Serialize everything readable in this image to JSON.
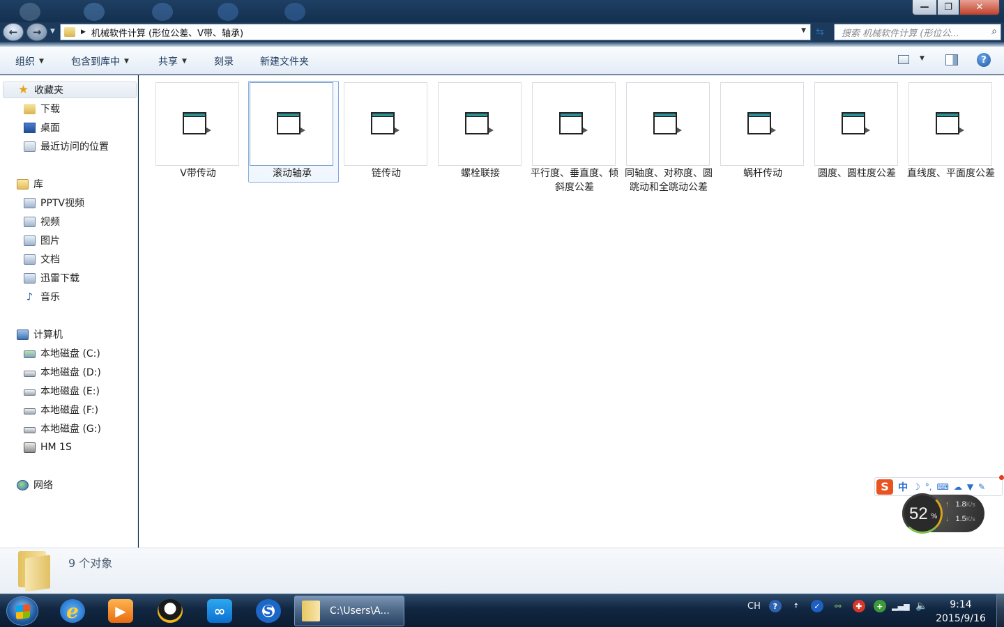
{
  "window": {
    "address_path": "机械软件计算 (形位公差、V带、轴承)",
    "search_placeholder": "搜索 机械软件计算 (形位公...",
    "controls": {
      "minimize": "—",
      "maximize": "❐",
      "close": "✕"
    }
  },
  "toolbar": {
    "organize": "组织",
    "include_in_library": "包含到库中",
    "share": "共享",
    "burn": "刻录",
    "new_folder": "新建文件夹",
    "help": "?"
  },
  "sidebar": {
    "favorites": {
      "label": "收藏夹",
      "items": [
        "下载",
        "桌面",
        "最近访问的位置"
      ]
    },
    "libraries": {
      "label": "库",
      "items": [
        "PPTV视频",
        "视频",
        "图片",
        "文档",
        "迅雷下载",
        "音乐"
      ]
    },
    "computer": {
      "label": "计算机",
      "items": [
        "本地磁盘 (C:)",
        "本地磁盘 (D:)",
        "本地磁盘 (E:)",
        "本地磁盘 (F:)",
        "本地磁盘 (G:)",
        "HM 1S"
      ]
    },
    "network": {
      "label": "网络"
    }
  },
  "files": [
    {
      "name": "V带传动",
      "selected": false
    },
    {
      "name": "滚动轴承",
      "selected": true
    },
    {
      "name": "链传动",
      "selected": false
    },
    {
      "name": "螺栓联接",
      "selected": false
    },
    {
      "name": "平行度、垂直度、倾斜度公差",
      "selected": false
    },
    {
      "name": "同轴度、对称度、圆跳动和全跳动公差",
      "selected": false
    },
    {
      "name": "蜗杆传动",
      "selected": false
    },
    {
      "name": "圆度、圆柱度公差",
      "selected": false
    },
    {
      "name": "直线度、平面度公差",
      "selected": false
    }
  ],
  "details": {
    "count_text": "9 个对象"
  },
  "ime": {
    "logo": "S",
    "mode": "中"
  },
  "net_monitor": {
    "percent": "52",
    "percent_symbol": "%",
    "upload": "1.8",
    "download": "1.5",
    "unit": "K/s"
  },
  "taskbar": {
    "explorer_label": "C:\\Users\\A...",
    "tray_lang": "CH",
    "time": "9:14",
    "date": "2015/9/16"
  },
  "icons": {
    "back": "back-arrow-icon",
    "forward": "forward-arrow-icon",
    "search": "search-icon",
    "refresh": "refresh-icon",
    "file": "application-window-icon"
  }
}
